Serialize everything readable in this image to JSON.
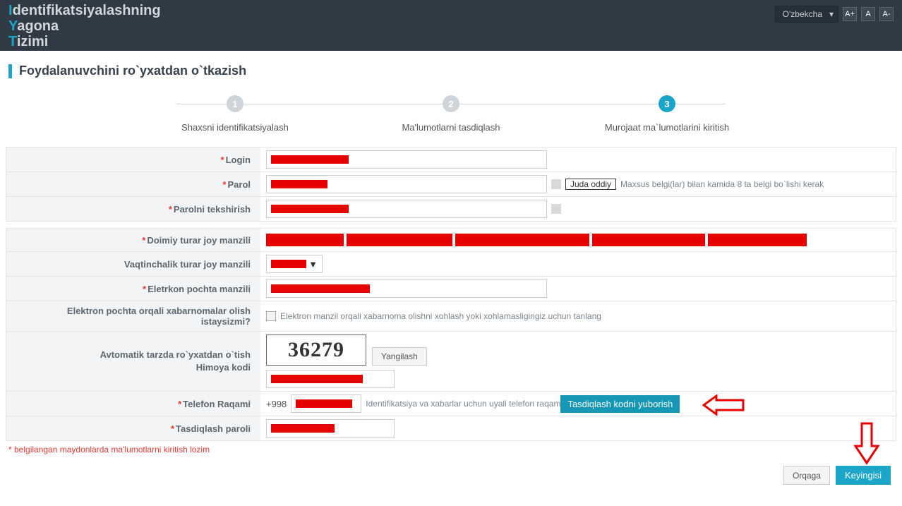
{
  "header": {
    "logo_line1_accent": "I",
    "logo_line1_rest": "dentifikatsiyalashning",
    "logo_line2_accent": "Y",
    "logo_line2_rest": "agona",
    "logo_line3_accent": "T",
    "logo_line3_rest": "izimi",
    "language": "O'zbekcha",
    "font_inc": "A+",
    "font_norm": "A",
    "font_dec": "A-"
  },
  "page": {
    "title": "Foydalanuvchini ro`yxatdan o`tkazish"
  },
  "steps": [
    {
      "num": "1",
      "label": "Shaxsni identifikatsiyalash"
    },
    {
      "num": "2",
      "label": "Ma'lumotlarni tasdiqlash"
    },
    {
      "num": "3",
      "label": "Murojaat ma`lumotlarini kiritish"
    }
  ],
  "fields": {
    "login": {
      "label": "Login"
    },
    "password": {
      "label": "Parol"
    },
    "password_confirm": {
      "label": "Parolni tekshirish"
    },
    "password_strength_badge": "Juda oddiy",
    "password_hint": "Maxsus belgi(lar) bilan kamida 8 ta belgi bo`lishi kerak",
    "perm_address": {
      "label": "Doimiy turar joy manzili"
    },
    "temp_address": {
      "label": "Vaqtinchalik turar joy manzili"
    },
    "email": {
      "label": "Eletrkon pochta manzili"
    },
    "email_notify": {
      "label": "Elektron pochta orqali xabarnomalar olish istaysizmi?",
      "checkbox_text": "Elektron manzil orqali xabarnoma olishni xohlash yoki xohlamasligingiz uchun tanlang"
    },
    "captcha": {
      "label_line1": "Avtomatik tarzda ro`yxatdan o`tish",
      "label_line2": "Himoya kodi",
      "value": "36279",
      "refresh": "Yangilash"
    },
    "phone": {
      "label": "Telefon Raqami",
      "prefix": "+998",
      "hint": "Identifikatsiya va xabarlar uchun uyali telefon raqam",
      "send_code": "Tasdiqlash kodni yuborish"
    },
    "confirm_code": {
      "label": "Tasdiqlash paroli"
    }
  },
  "footnote": "* belgilangan maydonlarda ma'lumotlarni kiritish lozim",
  "buttons": {
    "back": "Orqaga",
    "next": "Keyingisi"
  }
}
